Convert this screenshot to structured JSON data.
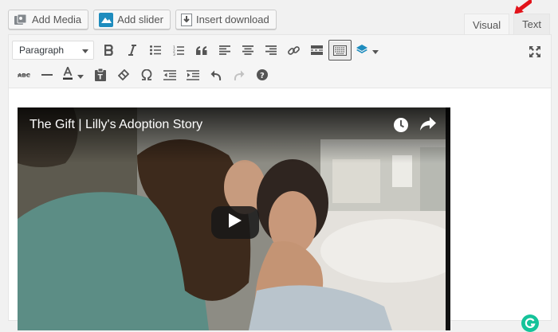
{
  "media_buttons": {
    "add_media": "Add Media",
    "add_slider": "Add slider",
    "insert_download": "Insert download"
  },
  "tabs": {
    "visual": "Visual",
    "text": "Text"
  },
  "toolbar": {
    "format_select_value": "Paragraph",
    "row1_icons": [
      "bold-icon",
      "italic-icon",
      "bulleted-list-icon",
      "numbered-list-icon",
      "blockquote-icon",
      "align-left-icon",
      "align-center-icon",
      "align-right-icon",
      "link-icon",
      "read-more-icon",
      "toolbar-toggle-icon",
      "layers-icon"
    ],
    "row2_icons": [
      "strikethrough-icon",
      "horizontal-line-icon",
      "text-color-icon",
      "paste-as-text-icon",
      "clear-formatting-icon",
      "special-character-icon",
      "outdent-icon",
      "indent-icon",
      "undo-icon",
      "redo-icon",
      "help-icon"
    ]
  },
  "video": {
    "title": "The Gift | Lilly's Adoption Story"
  },
  "colors": {
    "accent": "#1e8cbe",
    "arrow": "#e2131a",
    "grammarly": "#15c39a"
  }
}
